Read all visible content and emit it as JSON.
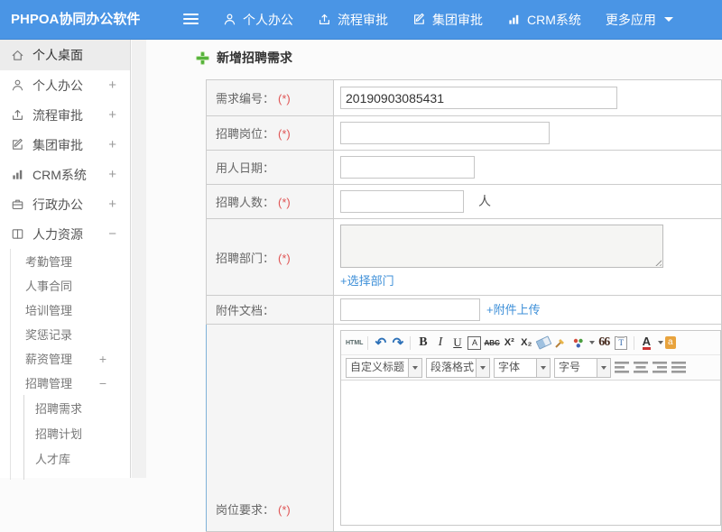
{
  "header": {
    "brand": "PHPOA协同办公软件",
    "nav": [
      {
        "label": "个人办公"
      },
      {
        "label": "流程审批"
      },
      {
        "label": "集团审批"
      },
      {
        "label": "CRM系统"
      },
      {
        "label": "更多应用"
      }
    ]
  },
  "sidebar": {
    "items": [
      {
        "label": "个人桌面",
        "expand": ""
      },
      {
        "label": "个人办公",
        "expand": "+"
      },
      {
        "label": "流程审批",
        "expand": "+"
      },
      {
        "label": "集团审批",
        "expand": "+"
      },
      {
        "label": "CRM系统",
        "expand": "+"
      },
      {
        "label": "行政办公",
        "expand": "+"
      },
      {
        "label": "人力资源",
        "expand": "−"
      }
    ],
    "hr_submenu": [
      {
        "label": "考勤管理",
        "expand": ""
      },
      {
        "label": "人事合同",
        "expand": ""
      },
      {
        "label": "培训管理",
        "expand": ""
      },
      {
        "label": "奖惩记录",
        "expand": ""
      },
      {
        "label": "薪资管理",
        "expand": "+"
      },
      {
        "label": "招聘管理",
        "expand": "−"
      }
    ],
    "recruit_submenu": [
      {
        "label": "招聘需求"
      },
      {
        "label": "招聘计划"
      },
      {
        "label": "人才库"
      }
    ]
  },
  "main": {
    "title": "新增招聘需求",
    "form": {
      "required_mark": "(*)",
      "rows": [
        {
          "label": "需求编号：",
          "value": "20190903085431"
        },
        {
          "label": "招聘岗位：",
          "value": ""
        },
        {
          "label": "用人日期：",
          "value": ""
        },
        {
          "label": "招聘人数：",
          "value": "",
          "suffix": "人"
        },
        {
          "label": "招聘部门：",
          "link": "+选择部门"
        },
        {
          "label": "附件文档：",
          "value": "",
          "link": "+附件上传"
        },
        {
          "label": "岗位要求："
        }
      ]
    },
    "editor": {
      "row1": {
        "html": "HTML",
        "undo": "↶",
        "redo": "↷",
        "bold": "B",
        "italic": "I",
        "underline": "U",
        "charstyle": "A",
        "strike": "ABC",
        "sup": "X²",
        "sub": "X₂",
        "quote": "66",
        "fontcolor": "A",
        "bgcolor": "a"
      },
      "row2": {
        "heading": "自定义标题",
        "paragraph": "段落格式",
        "font": "字体",
        "size": "字号"
      }
    }
  },
  "colors": {
    "topbar": "#4a95e5",
    "link": "#3d8fd8",
    "required": "#e05555",
    "title_plus": "#56b33c",
    "editor_blue_border": "#7fb2d8"
  }
}
